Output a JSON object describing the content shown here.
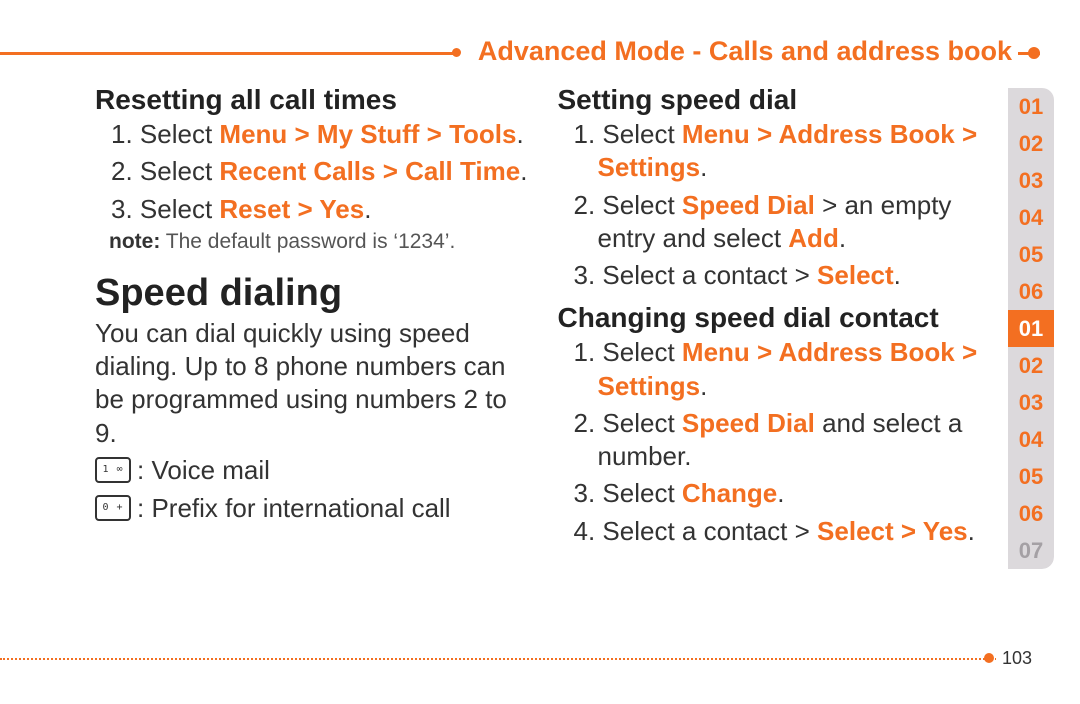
{
  "header": {
    "title": "Advanced Mode - Calls and address book"
  },
  "left": {
    "h_reset": "Resetting all call times",
    "steps_reset": {
      "s1_pre": "1. Select ",
      "s1_hl": "Menu > My Stuff > Tools",
      "s1_post": ".",
      "s2_pre": "2. Select ",
      "s2_hl": "Recent Calls > Call Time",
      "s2_post": ".",
      "s3_pre": "3. Select ",
      "s3_hl": "Reset > Yes",
      "s3_post": "."
    },
    "note_label": "note:",
    "note_text": " The default password is ‘1234’.",
    "h_speed": "Speed dialing",
    "speed_body": "You can dial quickly using speed dialing. Up to 8 phone numbers can be programmed using numbers 2 to 9.",
    "key_1_glyph": "1 ∞",
    "key_1_text": " : Voice mail",
    "key_0_glyph": "0 +",
    "key_0_text": " : Prefix for international call"
  },
  "right": {
    "h_set": "Setting speed dial",
    "set": {
      "s1_pre": "1. Select ",
      "s1_hl": "Menu > Address Book > Settings",
      "s1_post": ".",
      "s2_a": "2. Select ",
      "s2_hl1": "Speed Dial",
      "s2_b": " > an empty entry and select ",
      "s2_hl2": "Add",
      "s2_c": ".",
      "s3_a": "3. Select a contact > ",
      "s3_hl": "Select",
      "s3_b": "."
    },
    "h_change": "Changing speed dial contact",
    "change": {
      "s1_pre": "1. Select ",
      "s1_hl": "Menu > Address Book > Settings",
      "s1_post": ".",
      "s2_a": "2. Select ",
      "s2_hl": "Speed Dial",
      "s2_b": " and select a number.",
      "s3_a": "3. Select ",
      "s3_hl": "Change",
      "s3_b": ".",
      "s4_a": "4. Select a contact > ",
      "s4_hl": "Select > Yes",
      "s4_b": "."
    }
  },
  "tabs": {
    "upper": [
      "01",
      "02",
      "03",
      "04",
      "05",
      "06"
    ],
    "lower": [
      "01",
      "02",
      "03",
      "04",
      "05",
      "06",
      "07"
    ],
    "active_lower_index": 0
  },
  "page_number": "103"
}
